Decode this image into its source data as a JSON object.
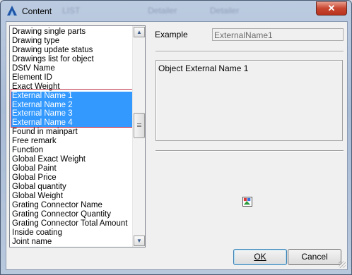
{
  "window": {
    "title": "Content",
    "close_label": "✕",
    "background_faint": [
      "LIST",
      "Detailer",
      "Detailer"
    ]
  },
  "list": {
    "items": [
      "Drawing single parts",
      "Drawing type",
      "Drawing update status",
      "Drawings list for object",
      "DStV Name",
      "Element ID",
      "Exact Weight",
      "External Name 1",
      "External Name 2",
      "External Name 3",
      "External Name 4",
      "Found in mainpart",
      "Free remark",
      "Function",
      "Global Exact Weight",
      "Global Paint",
      "Global Price",
      "Global quantity",
      "Global Weight",
      "Grating Connector Name",
      "Grating Connector Quantity",
      "Grating Connector Total Amount",
      "Inside coating",
      "Joint name"
    ],
    "selected": [
      7
    ],
    "scroll_up": "▲",
    "scroll_down": "▼"
  },
  "example": {
    "label": "Example",
    "value": "ExternalName1"
  },
  "description": "Object External Name 1",
  "buttons": {
    "ok": "OK",
    "cancel": "Cancel"
  },
  "colors": {
    "selection": "#3399ff",
    "highlight_border": "#c0304a",
    "close_button": "#c8452f"
  }
}
